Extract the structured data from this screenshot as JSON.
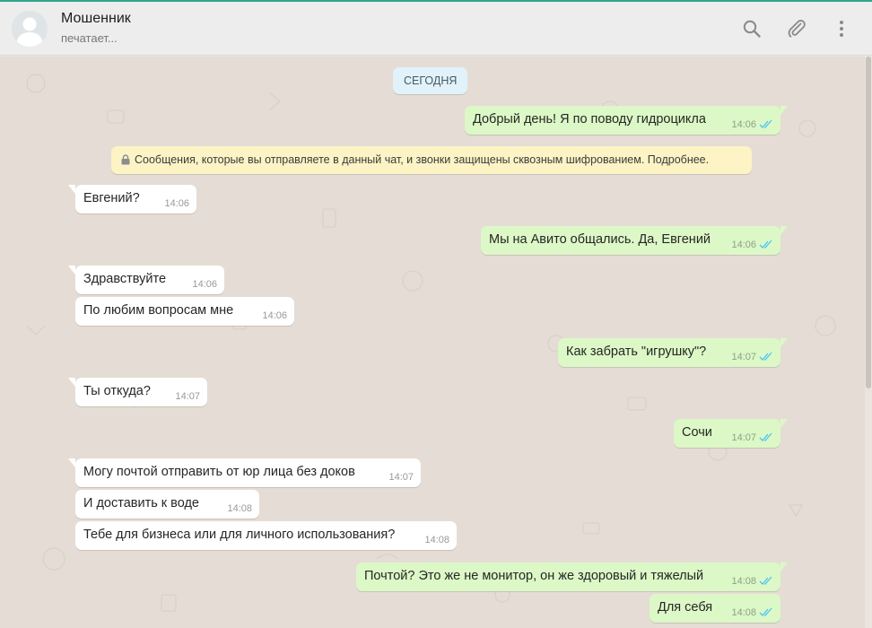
{
  "header": {
    "contact_name": "Мошенник",
    "status": "печатает...",
    "icons": [
      "search-icon",
      "attach-icon",
      "menu-icon"
    ]
  },
  "chat": {
    "date_label": "СЕГОДНЯ",
    "encryption_notice": "Сообщения, которые вы отправляете в данный чат, и звонки защищены сквозным шифрованием. Подробнее.",
    "messages": [
      {
        "dir": "out",
        "text": "Добрый день! Я по поводу гидроцикла",
        "time": "14:06"
      },
      {
        "dir": "in",
        "text": "Евгений?",
        "time": "14:06"
      },
      {
        "dir": "out",
        "text": "Мы на Авито общались. Да, Евгений",
        "time": "14:06"
      },
      {
        "dir": "in",
        "text": "Здравствуйте",
        "time": "14:06"
      },
      {
        "dir": "in",
        "text": "По любим вопросам мне",
        "time": "14:06"
      },
      {
        "dir": "out",
        "text": "Как забрать \"игрушку\"?",
        "time": "14:07"
      },
      {
        "dir": "in",
        "text": "Ты откуда?",
        "time": "14:07"
      },
      {
        "dir": "out",
        "text": "Сочи",
        "time": "14:07"
      },
      {
        "dir": "in",
        "text": "Могу почтой отправить от юр лица без доков",
        "time": "14:07"
      },
      {
        "dir": "in",
        "text": "И доставить к воде",
        "time": "14:08"
      },
      {
        "dir": "in",
        "text": "Тебе для бизнеса или для личного использования?",
        "time": "14:08"
      },
      {
        "dir": "out",
        "text": "Почтой? Это же не монитор, он же здоровый и тяжелый",
        "time": "14:08"
      },
      {
        "dir": "out",
        "text": "Для себя",
        "time": "14:08"
      }
    ]
  },
  "colors": {
    "accent": "#2fa58f",
    "header_bg": "#ededed",
    "chat_bg": "#e5ddd5",
    "incoming_bubble": "#ffffff",
    "outgoing_bubble": "#dcf8c6",
    "read_tick": "#4fc3f7",
    "notice_bg": "#fdf4c5",
    "date_chip_bg": "#e1f2fb"
  }
}
